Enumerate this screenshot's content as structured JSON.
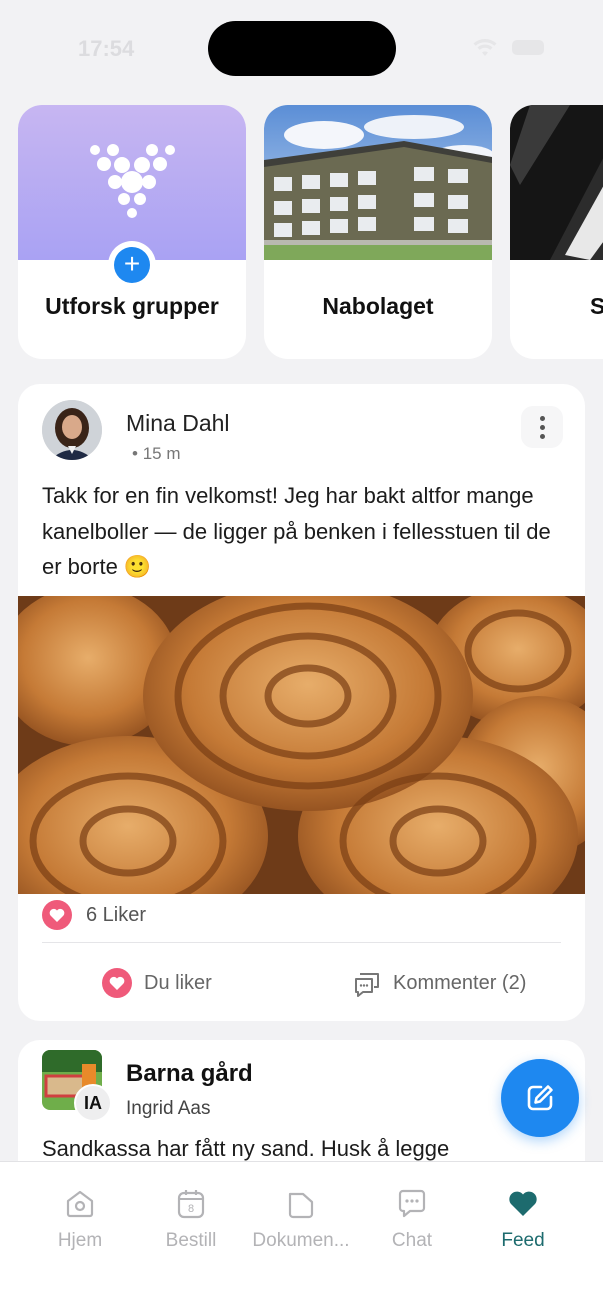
{
  "status_bar": {
    "time": "17:54"
  },
  "groups": [
    {
      "label": "Utforsk grupper",
      "icon": "plus-icon"
    },
    {
      "label": "Nabolaget"
    },
    {
      "label": "S"
    }
  ],
  "post": {
    "author": "Mina Dahl",
    "time": "15 m",
    "text": "Takk for en fin velkomst! Jeg har bakt altfor mange kanelboller — de ligger på benken i fellesstuen til de er borte 🙂",
    "likes": "6 Liker",
    "like_action": "Du liker",
    "comment_action": "Kommenter (2)"
  },
  "post2": {
    "title": "Barna gård",
    "subtitle": "Ingrid Aas",
    "badge": "IA",
    "text": "Sandkassa har fått ny sand. Husk å legge"
  },
  "tabs": [
    {
      "label": "Hjem",
      "icon": "home-icon"
    },
    {
      "label": "Bestill",
      "icon": "calendar-icon",
      "badge": "8"
    },
    {
      "label": "Dokumen...",
      "icon": "folder-icon"
    },
    {
      "label": "Chat",
      "icon": "chat-icon"
    },
    {
      "label": "Feed",
      "icon": "heart-icon",
      "active": true
    }
  ],
  "colors": {
    "accent": "#1e88f0",
    "active_tab": "#1d6b6e",
    "like": "#ef5a7a"
  }
}
